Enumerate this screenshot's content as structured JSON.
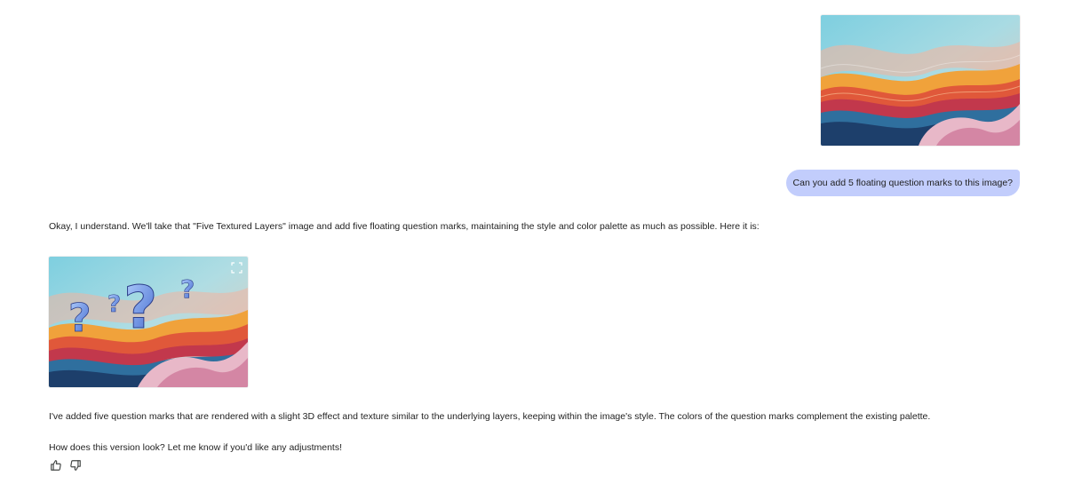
{
  "conversation": {
    "user_message": "Can you add 5 floating question marks to this image?",
    "assistant_intro": "Okay, I understand. We'll take that \"Five Textured Layers\" image and add five floating question marks, maintaining the style and color palette as much as possible. Here it is:",
    "assistant_description": "I've added five question marks that are rendered with a slight 3D effect and texture similar to the underlying layers, keeping within the image's style. The colors of the question marks complement the existing palette.",
    "assistant_followup": "How does this version look? Let me know if you'd like any adjustments!"
  },
  "icons": {
    "expand": "expand-icon",
    "thumbs_up": "thumbs-up-icon",
    "thumbs_down": "thumbs-down-icon"
  },
  "colors": {
    "user_bubble": "#c2cdfc",
    "text": "#1f1f1f",
    "sky": "#8fd3df",
    "question_mark": "#7fa8e8"
  }
}
